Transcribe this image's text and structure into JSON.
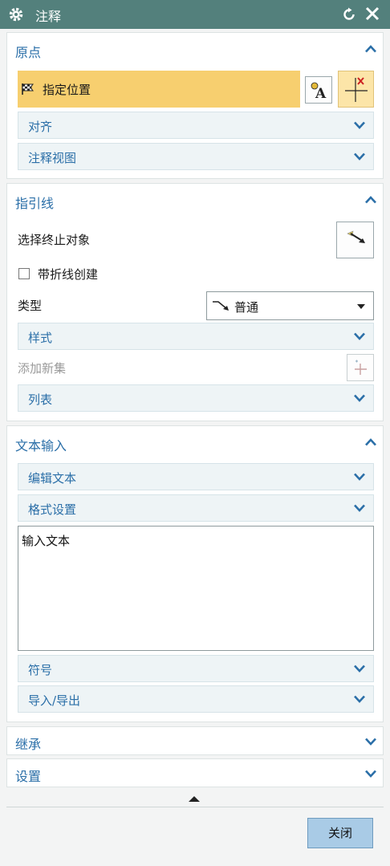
{
  "titlebar": {
    "title": "注释"
  },
  "origin": {
    "title": "原点",
    "specify_location": "指定位置",
    "align": "对齐",
    "annotation_view": "注释视图"
  },
  "leader": {
    "title": "指引线",
    "select_terminating_object": "选择终止对象",
    "with_jog_create": "带折线创建",
    "type_label": "类型",
    "type_value": "普通",
    "style": "样式",
    "add_new_set": "添加新集",
    "list": "列表"
  },
  "text_input": {
    "title": "文本输入",
    "edit_text": "编辑文本",
    "format_settings": "格式设置",
    "text_value": "输入文本",
    "symbols": "符号",
    "import_export": "导入/导出"
  },
  "inherit": {
    "title": "继承"
  },
  "settings": {
    "title": "设置"
  },
  "footer": {
    "close_label": "关闭"
  },
  "colors": {
    "titlebar": "#53807c",
    "section_title": "#2b6fa8",
    "highlight": "#f7cf6f",
    "close_button": "#a9cbe6"
  }
}
